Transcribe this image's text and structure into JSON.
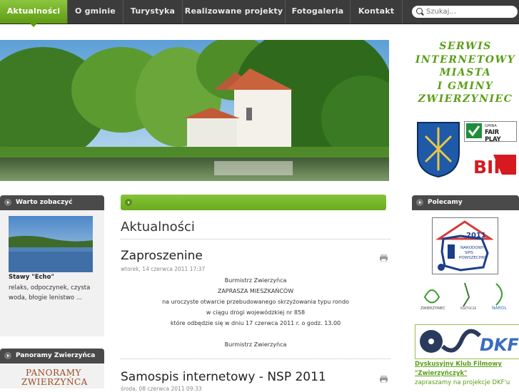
{
  "nav": {
    "items": [
      "Aktualności",
      "O gminie",
      "Turystyka",
      "Realizowane projekty",
      "Fotogaleria",
      "Kontakt"
    ],
    "active": 0,
    "search_placeholder": "Szukaj..."
  },
  "sidebar_right": {
    "serwis_lines": [
      "SERWIS",
      "INTERNETOWY",
      "MIASTA",
      "I GMINY",
      "ZWIERZYNIEC"
    ],
    "fairplay_small": "GMINA",
    "fairplay_big": "FAIR PLAY",
    "bip_label": "BIP",
    "polecamy_title": "Polecamy",
    "nsp_year": "2011",
    "nsp_lines": [
      "NARODOWY",
      "SPIS",
      "POWSZECHNY"
    ],
    "logo_captions": [
      "ZWIERZYNIEC",
      "ROZTOCZE",
      "NAROL"
    ],
    "dkf_text": "DKF",
    "dkf_link_line1": "Dyskusyjny Klub Filmowy",
    "dkf_link_line2": "\"Zwierzyńczyk\"",
    "dkf_sub": "zapraszamy na projekcje DKF'u"
  },
  "sidebar_left": {
    "warto_title": "Warto zobaczyć",
    "stawy_title": "Stawy \"Echo\"",
    "stawy_desc": "relaks, odpoczynek, czysta woda, błogie lenistwo ...",
    "panoramy_title": "Panoramy Zwierzyńca",
    "panorama_line1": "PANORAMY",
    "panorama_line2": "ZWIERZYŃCA"
  },
  "main": {
    "page_title": "Aktualności",
    "articles": [
      {
        "title": "Zaproszenine",
        "date": "wtorek, 14 czerwca 2011 17:37",
        "lines": [
          "Burmistrz Zwierzyńca",
          "ZAPRASZA MIESZKAŃCÓW",
          "na uroczyste otwarcie przebudowanego skrzyżowania typu rondo",
          "w ciągu drogi wojewódzkiej nr 858",
          "które odbędzie się w dniu 17 czerwca 2011 r. o godz. 13.00",
          "",
          "Burmistrz Zwierzyńca"
        ]
      },
      {
        "title": "Samospis internetowy - NSP 2011",
        "date": "środa, 08 czerwca 2011 09:33"
      }
    ]
  },
  "colors": {
    "accent": "#6aab1f",
    "nav_bg": "#3c3c3c",
    "box_head": "#4a4a4a",
    "serwis_text": "#5a9e16"
  }
}
